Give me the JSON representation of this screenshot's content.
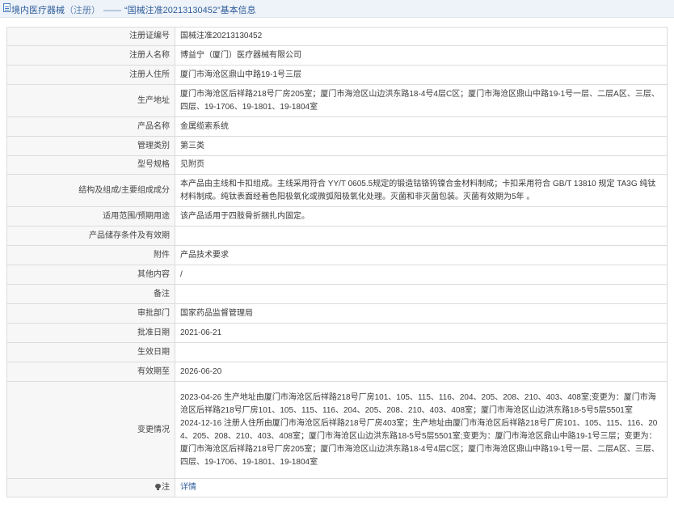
{
  "header": {
    "prefix": "境内医疗器械",
    "paren": "（注册）",
    "dash": "——",
    "quote_title": "“国械注准20213130452”",
    "suffix": "基本信息"
  },
  "rows": [
    {
      "label": "注册证编号",
      "value": "国械注准20213130452"
    },
    {
      "label": "注册人名称",
      "value": "博益宁（厦门）医疗器械有限公司"
    },
    {
      "label": "注册人住所",
      "value": "厦门市海沧区鼎山中路19-1号三层"
    },
    {
      "label": "生产地址",
      "value": "厦门市海沧区后祥路218号厂房205室；厦门市海沧区山边洪东路18-4号4层C区；厦门市海沧区鼎山中路19-1号一层、二层A区、三层、四层、19-1706、19-1801、19-1804室"
    },
    {
      "label": "产品名称",
      "value": "金属缆索系统"
    },
    {
      "label": "管理类别",
      "value": "第三类"
    },
    {
      "label": "型号规格",
      "value": "见附页"
    },
    {
      "label": "结构及组成/主要组成成分",
      "value": "本产品由主线和卡扣组成。主线采用符合 YY/T 0605.5规定的锻造钴铬钨镍合金材料制成；卡扣采用符合 GB/T 13810 规定 TA3G 纯钛材料制成。纯钛表面经着色阳极氧化或微弧阳极氧化处理。灭菌和非灭菌包装。灭菌有效期为5年 。"
    },
    {
      "label": "适用范围/预期用途",
      "value": "该产品适用于四肢骨折捆扎内固定。"
    },
    {
      "label": "产品储存条件及有效期",
      "value": ""
    },
    {
      "label": "附件",
      "value": "产品技术要求"
    },
    {
      "label": "其他内容",
      "value": "/"
    },
    {
      "label": "备注",
      "value": ""
    },
    {
      "label": "审批部门",
      "value": "国家药品监督管理局"
    },
    {
      "label": "批准日期",
      "value": "2021-06-21"
    },
    {
      "label": "生效日期",
      "value": ""
    },
    {
      "label": "有效期至",
      "value": "2026-06-20"
    }
  ],
  "changes": {
    "label": "变更情况",
    "entries": [
      "2023-04-26 生产地址由厦门市海沧区后祥路218号厂房101、105、115、116、204、205、208、210、403、408室;变更为：厦门市海沧区后祥路218号厂房101、105、115、116、204、205、208、210、403、408室；厦门市海沧区山边洪东路18-5号5层5501室",
      "2024-12-16 注册人住所由厦门市海沧区后祥路218号厂房403室；生产地址由厦门市海沧区后祥路218号厂房101、105、115、116、204、205、208、210、403、408室；厦门市海沧区山边洪东路18-5号5层5501室;变更为：厦门市海沧区鼎山中路19-1号三层；变更为：厦门市海沧区后祥路218号厂房205室；厦门市海沧区山边洪东路18-4号4层C区；厦门市海沧区鼎山中路19-1号一层、二层A区、三层、四层、19-1706、19-1801、19-1804室"
    ]
  },
  "footer_row": {
    "label": "注",
    "icon": "bulb-icon",
    "link_text": "详情"
  }
}
